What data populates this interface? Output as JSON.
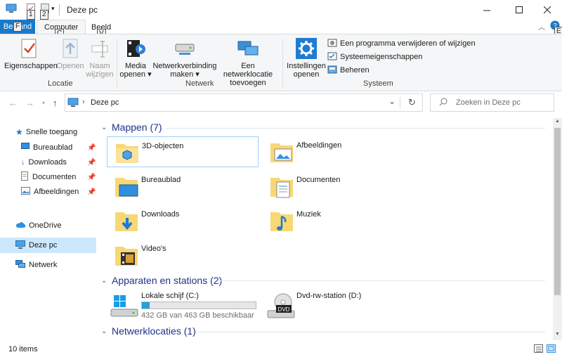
{
  "window": {
    "title": "Deze pc",
    "keytips": {
      "qa1": "1",
      "qa2": "2",
      "file": "F",
      "computer": "C",
      "view": "V",
      "help": "E"
    }
  },
  "ribbon": {
    "tabs": {
      "file": "Bestand",
      "computer": "Computer",
      "view": "Beeld"
    },
    "location": {
      "label": "Locatie",
      "properties": "Eigenschappen",
      "open": "Openen",
      "rename_line1": "Naam",
      "rename_line2": "wijzigen"
    },
    "network": {
      "label": "Netwerk",
      "media_line1": "Media",
      "media_line2": "openen",
      "map_line1": "Netwerkverbinding",
      "map_line2": "maken",
      "add_line1": "Een netwerklocatie",
      "add_line2": "toevoegen"
    },
    "system": {
      "label": "Systeem",
      "settings_line1": "Instellingen",
      "settings_line2": "openen",
      "uninstall": "Een programma verwijderen of wijzigen",
      "sysprops": "Systeemeigenschappen",
      "manage": "Beheren"
    }
  },
  "address": {
    "path": "Deze pc",
    "search_placeholder": "Zoeken in Deze pc"
  },
  "navpane": {
    "quick_access": "Snelle toegang",
    "quick_items": [
      "Bureaublad",
      "Downloads",
      "Documenten",
      "Afbeeldingen"
    ],
    "onedrive": "OneDrive",
    "this_pc": "Deze pc",
    "network": "Netwerk"
  },
  "content": {
    "folders_header": "Mappen (7)",
    "folders": [
      "3D-objecten",
      "Afbeeldingen",
      "Bureaublad",
      "Documenten",
      "Downloads",
      "Muziek",
      "Video's"
    ],
    "devices_header": "Apparaten en stations (2)",
    "drive_c": {
      "name": "Lokale schijf (C:)",
      "free": "432 GB van 463 GB beschikbaar",
      "used_fraction": 0.067
    },
    "drive_d": {
      "name": "Dvd-rw-station (D:)",
      "badge": "DVD"
    },
    "netloc_header": "Netwerklocaties (1)"
  },
  "status": {
    "items": "10 items"
  },
  "colors": {
    "accent": "#1979ca",
    "folder": "#f8d775",
    "selection": "#cce8ff",
    "header": "#1e3287"
  }
}
